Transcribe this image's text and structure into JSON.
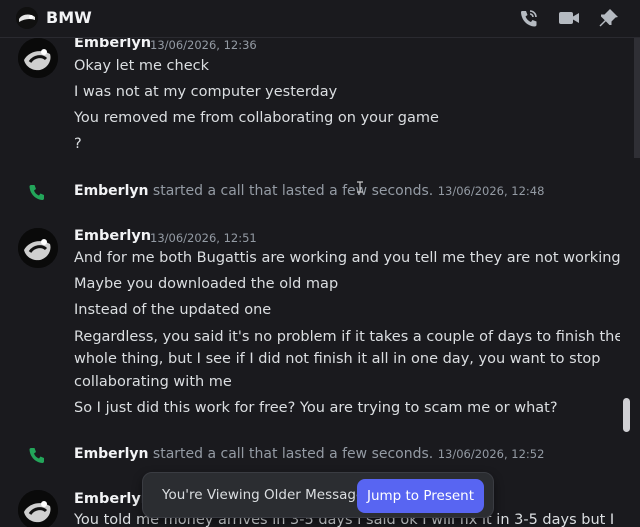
{
  "header": {
    "title": "BMW",
    "icons": [
      "phone-call-icon",
      "video-camera-icon",
      "pin-icon"
    ]
  },
  "messages": {
    "group1": {
      "author": "Emberlyn",
      "timestamp": "13/06/2026, 12:36",
      "lines": [
        "Okay let me check",
        "I was not at my computer yesterday",
        "You removed me from collaborating on your game",
        "?"
      ]
    },
    "call1": {
      "name": "Emberlyn",
      "text": " started a call that lasted a few seconds.",
      "timestamp": "13/06/2026, 12:48"
    },
    "group2": {
      "author": "Emberlyn",
      "timestamp": "13/06/2026, 12:51",
      "lines": [
        "And for me both Bugattis are working and you tell me they are not working",
        "Maybe you downloaded the old map",
        "Instead of the updated one",
        "Regardless, you said it's no problem if it takes a couple of days to finish the",
        "whole thing, but I see if I did not finish it all in one day, you want to stop",
        "collaborating with me",
        "So I just did this work for free? You are trying to scam me or what?"
      ]
    },
    "call2": {
      "name": "Emberlyn",
      "text": " started a call that lasted a few seconds.",
      "timestamp": "13/06/2026, 12:52"
    },
    "group3": {
      "author": "Emberlyn",
      "lines": [
        "You told me money arrives in 3-5 days I said ok I will fix it in 3-5 days but I"
      ]
    }
  },
  "older_banner": {
    "text": "You're Viewing Older Messages",
    "button": "Jump to Present"
  },
  "colors": {
    "background": "#1a1a1e",
    "accent": "#5865f2",
    "call_green": "#23a55a"
  }
}
